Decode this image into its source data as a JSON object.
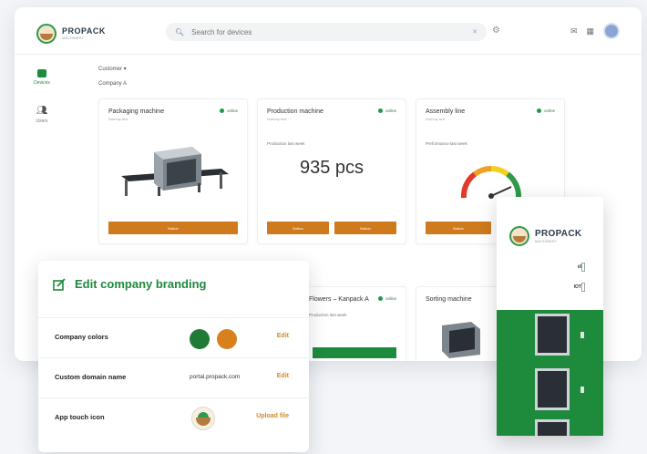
{
  "app": {
    "logo_name": "PROPACK",
    "logo_sub": "MACHINERY",
    "search_placeholder": "Search for devices"
  },
  "sidebar": [
    {
      "label": "Devices",
      "icon": "devices-icon",
      "active": true
    },
    {
      "label": "Users",
      "icon": "users-icon",
      "active": false
    }
  ],
  "filters": {
    "first": "Customer ▾",
    "second": "Company A"
  },
  "status_label": "online",
  "cards": [
    {
      "title": "Packaging machine",
      "subtitle": "Dummy text",
      "buttons": [
        "Button"
      ]
    },
    {
      "title": "Production machine",
      "subtitle": "Dummy text",
      "metric_label": "Production last week",
      "value": "935 pcs",
      "buttons": [
        "Button",
        "Button"
      ]
    },
    {
      "title": "Assembly line",
      "subtitle": "Dummy text",
      "metric_label": "Performance last week",
      "buttons": [
        "Button"
      ]
    },
    {
      "title": "Flowers – Kanpack A",
      "metric_label": "Production last week"
    },
    {
      "title": "Sorting machine"
    }
  ],
  "branding": {
    "title": "Edit company branding",
    "rows": [
      {
        "label": "Company colors",
        "action": "Edit"
      },
      {
        "label": "Custom domain name",
        "value": "portal.propack.com",
        "action": "Edit"
      },
      {
        "label": "App touch icon",
        "action": "Upload file"
      }
    ],
    "colors": [
      "#1e7a35",
      "#d9801e"
    ]
  },
  "device": {
    "name": "PROPACK",
    "sub": "MACHINERY",
    "ind1": "ıll",
    "ind2": "IOT"
  }
}
